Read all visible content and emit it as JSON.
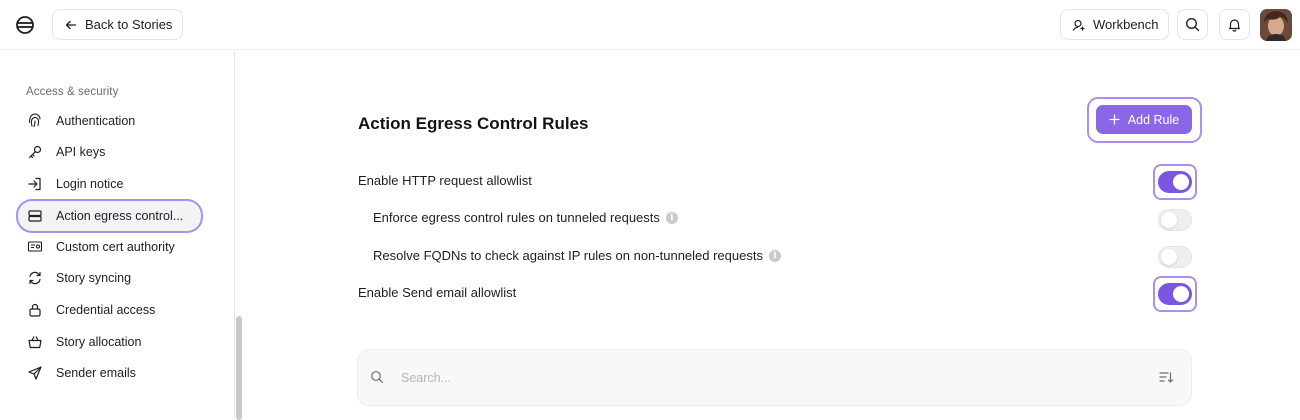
{
  "header": {
    "back_label": "Back to Stories",
    "workbench_label": "Workbench"
  },
  "sidebar": {
    "section_label": "Access & security",
    "items": [
      {
        "label": "Authentication",
        "icon": "fingerprint-icon"
      },
      {
        "label": "API keys",
        "icon": "key-icon"
      },
      {
        "label": "Login notice",
        "icon": "login-icon"
      },
      {
        "label": "Action egress control...",
        "icon": "server-icon",
        "active": true
      },
      {
        "label": "Custom cert authority",
        "icon": "certificate-icon"
      },
      {
        "label": "Story syncing",
        "icon": "sync-icon"
      },
      {
        "label": "Credential access",
        "icon": "lock-icon"
      },
      {
        "label": "Story allocation",
        "icon": "basket-icon"
      },
      {
        "label": "Sender emails",
        "icon": "send-icon"
      }
    ]
  },
  "main": {
    "title": "Action Egress Control Rules",
    "add_rule_label": "Add Rule",
    "settings": [
      {
        "label": "Enable HTTP request allowlist",
        "enabled": true,
        "info": false
      },
      {
        "label": "Enforce egress control rules on tunneled requests",
        "enabled": false,
        "info": true
      },
      {
        "label": "Resolve FQDNs to check against IP rules on non-tunneled requests",
        "enabled": false,
        "info": true
      },
      {
        "label": "Enable Send email allowlist",
        "enabled": true,
        "info": false
      }
    ],
    "search": {
      "placeholder": "Search..."
    }
  },
  "colors": {
    "accent": "#8b66e6",
    "toggle_on": "#7c55e0",
    "highlight_ring": "#a88ff0"
  }
}
